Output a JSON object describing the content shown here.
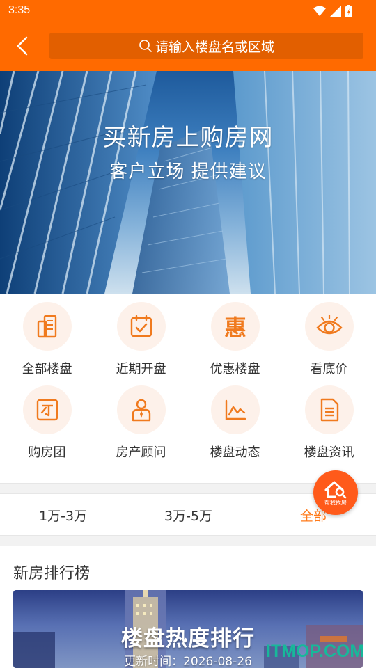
{
  "status_bar": {
    "time": "3:35"
  },
  "header": {
    "search_placeholder": "请输入楼盘名或区域"
  },
  "banner": {
    "line1": "买新房上购房网",
    "line2": "客户立场  提供建议"
  },
  "grid": [
    {
      "label": "全部楼盘",
      "icon": "buildings-icon"
    },
    {
      "label": "近期开盘",
      "icon": "calendar-check-icon"
    },
    {
      "label": "优惠楼盘",
      "icon": "discount-hui-icon"
    },
    {
      "label": "看底价",
      "icon": "eye-icon"
    },
    {
      "label": "购房团",
      "icon": "group-buy-icon"
    },
    {
      "label": "房产顾问",
      "icon": "advisor-icon"
    },
    {
      "label": "楼盘动态",
      "icon": "trend-chart-icon"
    },
    {
      "label": "楼盘资讯",
      "icon": "news-document-icon"
    }
  ],
  "grid_icon_glyph_hui": "惠",
  "fab": {
    "label": "帮我找房"
  },
  "filters": [
    {
      "label": "1万-3万",
      "active": false
    },
    {
      "label": "3万-5万",
      "active": false
    },
    {
      "label": "全部",
      "active": true
    }
  ],
  "ranking": {
    "section_title": "新房排行榜",
    "card_title": "楼盘热度排行",
    "card_update": "更新时间：2026-08-26"
  },
  "watermark": "ITMOP.COM",
  "colors": {
    "brand": "#ff6a00",
    "icon_orange": "#f07a1e",
    "active_filter": "#ff7a1a",
    "watermark": "#17b89a"
  }
}
